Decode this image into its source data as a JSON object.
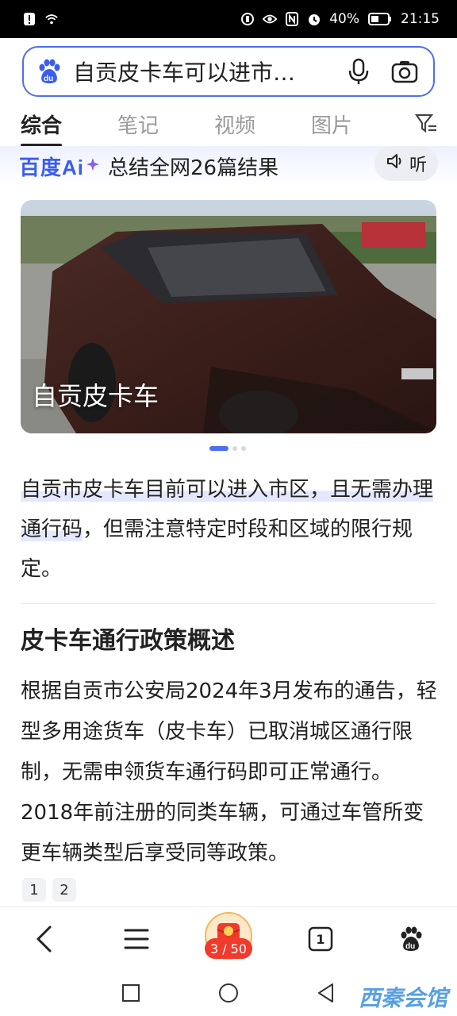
{
  "status_bar": {
    "battery": "40%",
    "time": "21:15"
  },
  "search": {
    "query": "自贡皮卡车可以进市…"
  },
  "tabs": [
    {
      "label": "综合",
      "active": true
    },
    {
      "label": "笔记",
      "active": false
    },
    {
      "label": "视频",
      "active": false
    },
    {
      "label": "图片",
      "active": false
    }
  ],
  "ai": {
    "logo": "百度Ai",
    "title": "总结全网26篇结果",
    "listen_label": "听"
  },
  "hero": {
    "caption": "自贡皮卡车",
    "page_count": 3,
    "page_index": 1
  },
  "summary": {
    "highlight_1": "自贡市皮卡车目前可以进入市区，且无需",
    "highlight_2": "办理通行码",
    "rest": "，但需注意特定时段和区域的限行规定。"
  },
  "section": {
    "heading": "皮卡车通行政策概述",
    "paragraph": "根据自贡市公安局2024年3月发布的通告，轻型多用途货车（皮卡车）已取消城区通行限制，无需申领货车通行码即可正常通行。2018年前注册的同类车辆，可通过车管所变更车辆类型后享受同等政策。"
  },
  "refs": [
    "1",
    "2"
  ],
  "toolbar": {
    "tabs_count": "1",
    "counter": "3 / 50"
  },
  "watermark": "西秦会馆",
  "colors": {
    "accent": "#4e6ef2",
    "red": "#f03a2b"
  }
}
